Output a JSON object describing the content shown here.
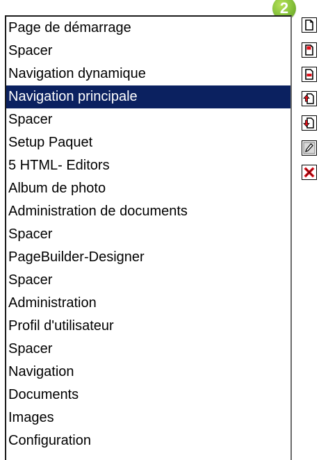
{
  "header": {
    "step_badge": "2"
  },
  "listbox": {
    "selected_index": 3,
    "items": [
      {
        "label": "Page de démarrage"
      },
      {
        "label": "Spacer"
      },
      {
        "label": "Navigation dynamique"
      },
      {
        "label": "Navigation principale"
      },
      {
        "label": "Spacer"
      },
      {
        "label": "Setup Paquet"
      },
      {
        "label": "5 HTML- Editors"
      },
      {
        "label": "Album de photo"
      },
      {
        "label": "Administration de documents"
      },
      {
        "label": "Spacer"
      },
      {
        "label": "PageBuilder-Designer"
      },
      {
        "label": "Spacer"
      },
      {
        "label": "Administration"
      },
      {
        "label": "Profil d'utilisateur"
      },
      {
        "label": "Spacer"
      },
      {
        "label": "Navigation"
      },
      {
        "label": "Documents"
      },
      {
        "label": "Images"
      },
      {
        "label": "Configuration"
      }
    ]
  },
  "toolbar": {
    "buttons": [
      {
        "icon": "new-page-icon"
      },
      {
        "icon": "insert-page-icon"
      },
      {
        "icon": "insert-page-below-icon"
      },
      {
        "icon": "move-up-icon"
      },
      {
        "icon": "move-down-icon"
      },
      {
        "icon": "edit-pencil-icon"
      },
      {
        "icon": "delete-icon"
      }
    ]
  },
  "colors": {
    "selection": "#0b2160",
    "badge": "#8cc63f",
    "accent_red": "#e0101a"
  }
}
